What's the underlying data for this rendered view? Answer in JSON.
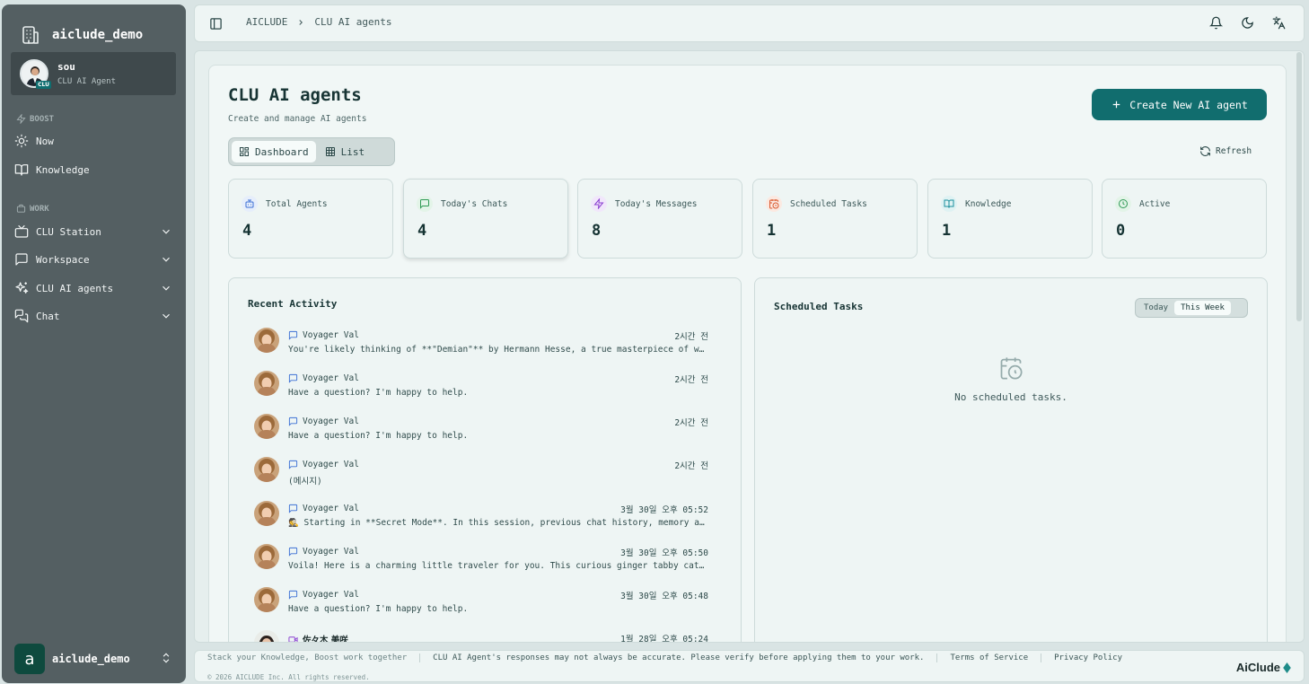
{
  "sidebar": {
    "brand": "aiclude_demo",
    "user": {
      "name": "sou",
      "role": "CLU AI Agent",
      "badge": "CLU"
    },
    "sections": [
      {
        "label": "BOOST",
        "items": [
          {
            "label": "Now",
            "icon": "sun-icon"
          },
          {
            "label": "Knowledge",
            "icon": "book-icon"
          }
        ]
      },
      {
        "label": "WORK",
        "items": [
          {
            "label": "CLU Station",
            "icon": "tv-icon"
          },
          {
            "label": "Workspace",
            "icon": "message-square-icon"
          },
          {
            "label": "CLU AI agents",
            "icon": "sparkles-icon"
          },
          {
            "label": "Chat",
            "icon": "messages-icon"
          }
        ]
      }
    ],
    "workspace": {
      "initial": "a",
      "name": "aiclude_demo"
    }
  },
  "topbar": {
    "breadcrumb": [
      "AICLUDE",
      "CLU AI agents"
    ]
  },
  "page": {
    "title": "CLU AI agents",
    "subtitle": "Create and manage AI agents",
    "create_label": "Create New AI agent",
    "view_dashboard": "Dashboard",
    "view_list": "List",
    "refresh_label": "Refresh"
  },
  "stats": [
    {
      "label": "Total Agents",
      "value": "4",
      "color": "#3b6fd4",
      "bg": "#e6eefb"
    },
    {
      "label": "Today's Chats",
      "value": "4",
      "color": "#2f9a55",
      "bg": "#e3f4e8"
    },
    {
      "label": "Today's Messages",
      "value": "8",
      "color": "#8a3fd1",
      "bg": "#f1e7fb"
    },
    {
      "label": "Scheduled Tasks",
      "value": "1",
      "color": "#d9572b",
      "bg": "#fbe9e1"
    },
    {
      "label": "Knowledge",
      "value": "1",
      "color": "#1a8f9c",
      "bg": "#dff2f3"
    },
    {
      "label": "Active",
      "value": "0",
      "color": "#2f9a55",
      "bg": "#e3f4e8"
    }
  ],
  "activity": {
    "title": "Recent Activity",
    "items": [
      {
        "name": "Voyager Val",
        "time": "2시간 전",
        "message": "You're likely thinking of **\"Demian\"** by Hermann Hesse, a true masterpiece of world literature",
        "kind": "chat"
      },
      {
        "name": "Voyager Val",
        "time": "2시간 전",
        "message": "Have a question? I'm happy to help.",
        "kind": "chat"
      },
      {
        "name": "Voyager Val",
        "time": "2시간 전",
        "message": "Have a question? I'm happy to help.",
        "kind": "chat"
      },
      {
        "name": "Voyager Val",
        "time": "2시간 전",
        "message": "(메시지)",
        "kind": "chat"
      },
      {
        "name": "Voyager Val",
        "time": "3월 30일 오후 05:52",
        "message": "🕵 Starting in **Secret Mode**. In this session, previous chat history, memory and knowledge",
        "kind": "chat"
      },
      {
        "name": "Voyager Val",
        "time": "3월 30일 오후 05:50",
        "message": "Voila! Here is a charming little traveler for you. This curious ginger tabby cat is ready",
        "kind": "chat"
      },
      {
        "name": "Voyager Val",
        "time": "3월 30일 오후 05:48",
        "message": "Have a question? I'm happy to help.",
        "kind": "chat"
      },
      {
        "name": "佐々木 美咲",
        "time": "1월 28일 오후 05:24",
        "message": "",
        "kind": "video"
      }
    ]
  },
  "scheduled": {
    "title": "Scheduled Tasks",
    "tab_today": "Today",
    "tab_week": "This Week",
    "empty": "No scheduled tasks."
  },
  "footer": {
    "tagline": "Stack your Knowledge, Boost work together",
    "disclaimer": "CLU AI Agent's responses may not always be accurate. Please verify before applying them to your work.",
    "terms": "Terms of Service",
    "privacy": "Privacy Policy",
    "copyright": "© 2026 AICLUDE Inc. All rights reserved.",
    "logo": "AiClude"
  }
}
